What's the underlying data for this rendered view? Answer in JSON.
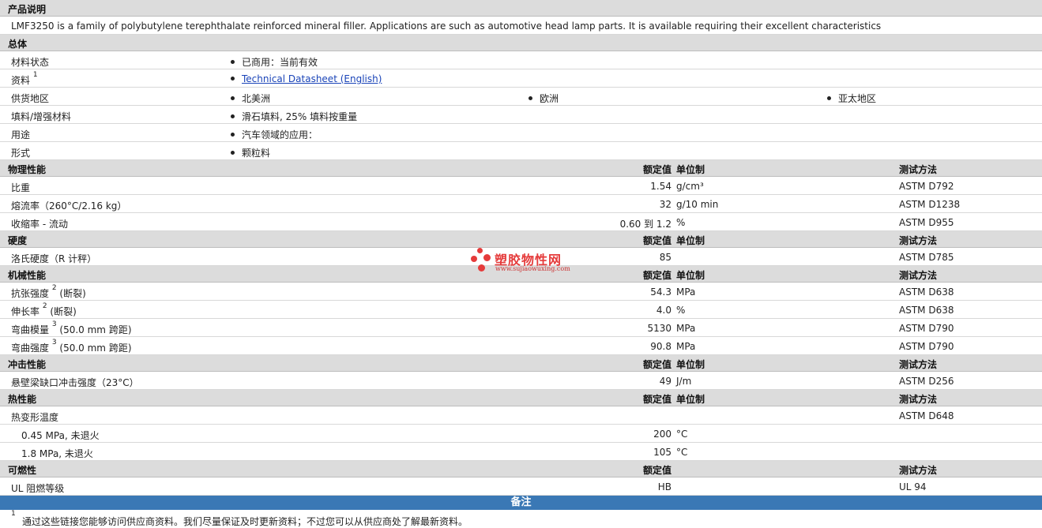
{
  "description": {
    "header": "产品说明",
    "text": "LMF3250 is a family of polybutylene terephthalate reinforced mineral filler. Applications are such as automotive head lamp parts. It is available requiring their excellent characteristics"
  },
  "general": {
    "header": "总体",
    "status_label": "材料状态",
    "status_value": "已商用：当前有效",
    "docs_label": "资料",
    "docs_sup": "1",
    "docs_link": "Technical Datasheet (English)",
    "region_label": "供货地区",
    "region_1": "北美洲",
    "region_2": "欧洲",
    "region_3": "亚太地区",
    "filler_label": "填料/增强材料",
    "filler_value": "滑石填料, 25% 填料按重量",
    "use_label": "用途",
    "use_value": "汽车领域的应用：",
    "form_label": "形式",
    "form_value": "颗粒料"
  },
  "col": {
    "value": "额定值",
    "unit": "单位制",
    "test": "测试方法"
  },
  "physical": {
    "header": "物理性能",
    "rows": [
      {
        "label": "比重",
        "value": "1.54",
        "unit": "g/cm³",
        "test": "ASTM D792"
      },
      {
        "label": "熔流率（260°C/2.16 kg）",
        "value": "32",
        "unit": "g/10 min",
        "test": "ASTM D1238"
      },
      {
        "label": "收缩率 - 流动",
        "value": "0.60 到  1.2",
        "unit": "%",
        "test": "ASTM D955"
      }
    ]
  },
  "hardness": {
    "header": "硬度",
    "rows": [
      {
        "label": "洛氏硬度（R 计秤）",
        "value": "85",
        "unit": "",
        "test": "ASTM D785"
      }
    ]
  },
  "mechanical": {
    "header": "机械性能",
    "rows": [
      {
        "label": "抗张强度",
        "sup": "2",
        "suffix": "(断裂)",
        "value": "54.3",
        "unit": "MPa",
        "test": "ASTM D638"
      },
      {
        "label": "伸长率",
        "sup": "2",
        "suffix": "(断裂)",
        "value": "4.0",
        "unit": "%",
        "test": "ASTM D638"
      },
      {
        "label": "弯曲模量",
        "sup": "3",
        "suffix": "(50.0 mm 跨距)",
        "value": "5130",
        "unit": "MPa",
        "test": "ASTM D790"
      },
      {
        "label": "弯曲强度",
        "sup": "3",
        "suffix": "(50.0 mm 跨距)",
        "value": "90.8",
        "unit": "MPa",
        "test": "ASTM D790"
      }
    ]
  },
  "impact": {
    "header": "冲击性能",
    "rows": [
      {
        "label": "悬壁梁缺口冲击强度（23°C）",
        "value": "49",
        "unit": "J/m",
        "test": "ASTM D256"
      }
    ]
  },
  "thermal": {
    "header": "热性能",
    "rows": [
      {
        "label": "热变形温度",
        "value": "",
        "unit": "",
        "test": "ASTM D648"
      },
      {
        "label": "0.45 MPa, 未退火",
        "value": "200",
        "unit": "°C",
        "test": ""
      },
      {
        "label": "1.8 MPa, 未退火",
        "value": "105",
        "unit": "°C",
        "test": ""
      }
    ]
  },
  "flammability": {
    "header": "可燃性",
    "rows": [
      {
        "label": "UL 阻燃等级",
        "value": "HB",
        "unit": "",
        "test": "UL 94"
      }
    ]
  },
  "notes": {
    "header": "备注",
    "sup": "1",
    "text": "通过这些链接您能够访问供应商资料。我们尽量保证及时更新资料；不过您可以从供应商处了解最新资料。"
  },
  "watermark": {
    "title": "塑胶物性网",
    "url": "www.sujiaowuxing.com",
    "color": "#e53b3b"
  }
}
